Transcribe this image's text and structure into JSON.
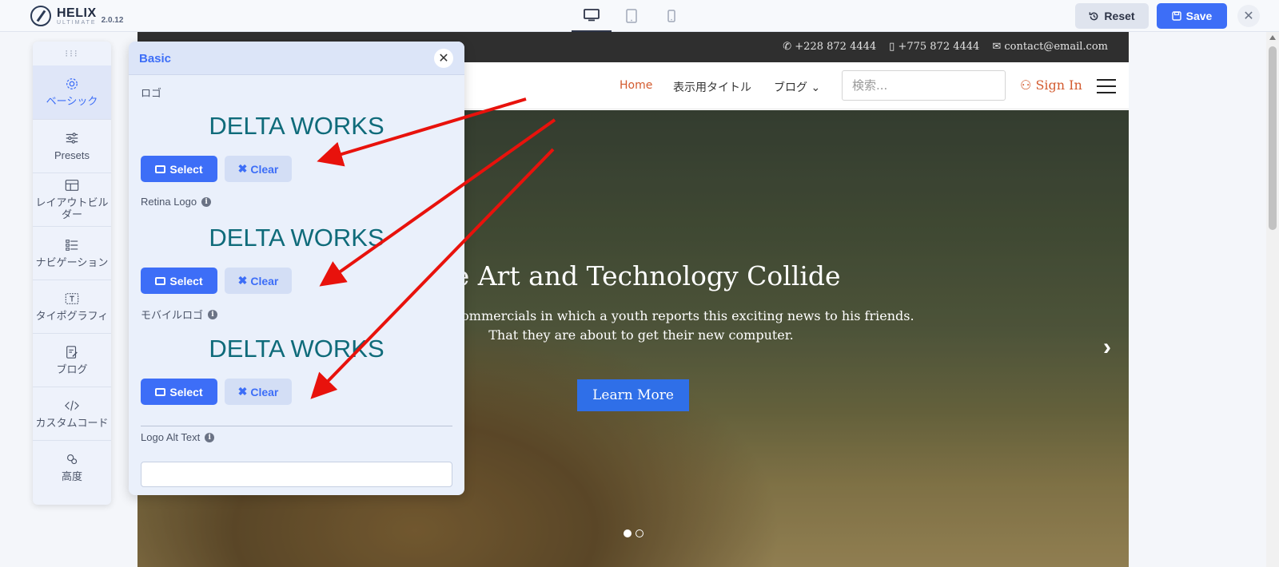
{
  "app": {
    "brand_name": "HELIX",
    "brand_sub": "ULTIMATE",
    "version": "2.0.12",
    "devices": [
      "desktop-icon",
      "tablet-icon",
      "mobile-icon"
    ],
    "reset_label": "Reset",
    "save_label": "Save",
    "close_glyph": "✕"
  },
  "sidebar": {
    "items": [
      {
        "label": "ベーシック",
        "icon": "gear-icon",
        "active": true
      },
      {
        "label": "Presets",
        "icon": "sliders-icon"
      },
      {
        "label": "レイアウトビルダー",
        "icon": "layout-icon"
      },
      {
        "label": "ナビゲーション",
        "icon": "list-icon"
      },
      {
        "label": "タイポグラフィ",
        "icon": "typography-icon"
      },
      {
        "label": "ブログ",
        "icon": "edit-icon"
      },
      {
        "label": "カスタムコード",
        "icon": "code-icon"
      },
      {
        "label": "高度",
        "icon": "advanced-icon"
      }
    ]
  },
  "panel": {
    "title": "Basic",
    "close_glyph": "✕",
    "fields": [
      {
        "label": "ロゴ",
        "logo_text": "DELTA WORKS",
        "info": false
      },
      {
        "label": "Retina Logo",
        "logo_text": "DELTA WORKS",
        "info": true
      },
      {
        "label": "モバイルロゴ",
        "logo_text": "DELTA WORKS",
        "info": true
      }
    ],
    "select_label": "Select",
    "clear_label": "Clear",
    "alt_label": "Logo Alt Text",
    "alt_value": "",
    "info_glyph": "i"
  },
  "site": {
    "phone": "+228 872 4444",
    "mobile": "+775 872 4444",
    "email": "contact@email.com",
    "nav": {
      "home": "Home",
      "title": "表示用タイトル",
      "blog": "ブログ"
    },
    "search_placeholder": "検索...",
    "sign_in": "Sign In",
    "hero_title": "ere Art and Technology Collide",
    "hero_text_1": "ell computer commercials in which a youth reports this exciting news to his friends.",
    "hero_text_2": "That they are about to get their new computer.",
    "hero_button": "Learn More",
    "slides": 2,
    "active_slide": 1
  },
  "annotations": {
    "arrow_color": "#e8120c",
    "arrow_count": 3
  }
}
